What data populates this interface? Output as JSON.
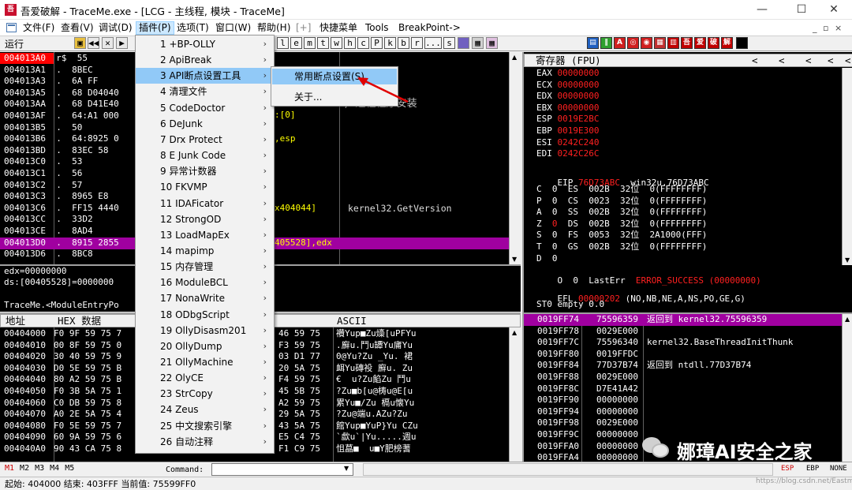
{
  "window": {
    "title": "吾爱破解 - TraceMe.exe - [LCG - 主线程, 模块 - TraceMe]",
    "logo_text": "吾",
    "minimize": "—",
    "maximize": "☐",
    "close": "✕",
    "mdi_controls": "_ ▫ ×"
  },
  "menubar": [
    {
      "label": "文件(F)"
    },
    {
      "label": "查看(V)"
    },
    {
      "label": "调试(D)"
    },
    {
      "label": "插件(P)"
    },
    {
      "label": "选项(T)"
    },
    {
      "label": "窗口(W)"
    },
    {
      "label": "帮助(H)"
    },
    {
      "label": "[+]"
    },
    {
      "label": "快捷菜单"
    },
    {
      "label": "Tools"
    },
    {
      "label": "BreakPoint->"
    }
  ],
  "toolbar": {
    "status": "运行",
    "letters": [
      "l",
      "e",
      "m",
      "t",
      "w",
      "h",
      "c",
      "P",
      "k",
      "b",
      "r",
      "...",
      "s"
    ],
    "colored": [
      "吾",
      "爱",
      "破",
      "解"
    ]
  },
  "plugins_menu": [
    {
      "label": "1 +BP-OLLY"
    },
    {
      "label": "2 ApiBreak"
    },
    {
      "label": "3 API断点设置工具"
    },
    {
      "label": "4 清理文件"
    },
    {
      "label": "5 CodeDoctor"
    },
    {
      "label": "6 DeJunk"
    },
    {
      "label": "7 Drx Protect"
    },
    {
      "label": "8 E Junk Code"
    },
    {
      "label": "9 异常计数器"
    },
    {
      "label": "10 FKVMP"
    },
    {
      "label": "11 IDAFicator"
    },
    {
      "label": "12 StrongOD"
    },
    {
      "label": "13 LoadMapEx"
    },
    {
      "label": "14 mapimp"
    },
    {
      "label": "15 内存管理"
    },
    {
      "label": "16 ModuleBCL"
    },
    {
      "label": "17 NonaWrite"
    },
    {
      "label": "18 ODbgScript"
    },
    {
      "label": "19 OllyDisasm201"
    },
    {
      "label": "20 OllyDump"
    },
    {
      "label": "21 OllyMachine"
    },
    {
      "label": "22 OlyCE"
    },
    {
      "label": "23 StrCopy"
    },
    {
      "label": "24 Zeus"
    },
    {
      "label": "25 中文搜索引擎"
    },
    {
      "label": "26 自动注释"
    }
  ],
  "sub_menu": [
    {
      "label": "常用断点设置(S)"
    },
    {
      "label": "关于..."
    }
  ],
  "disasm": {
    "rows": [
      {
        "addr": "004013A0",
        "mark": "r$",
        "bytes": "55"
      },
      {
        "addr": "004013A1",
        "mark": ".",
        "bytes": "8BEC"
      },
      {
        "addr": "004013A3",
        "mark": ".",
        "bytes": "6A FF"
      },
      {
        "addr": "004013A5",
        "mark": ".",
        "bytes": "68 D04040"
      },
      {
        "addr": "004013AA",
        "mark": ".",
        "bytes": "68 D41E40"
      },
      {
        "addr": "004013AF",
        "mark": ".",
        "bytes": "64:A1 000"
      },
      {
        "addr": "004013B5",
        "mark": ".",
        "bytes": "50"
      },
      {
        "addr": "004013B6",
        "mark": ".",
        "bytes": "64:8925 0"
      },
      {
        "addr": "004013BD",
        "mark": ".",
        "bytes": "83EC 58"
      },
      {
        "addr": "004013C0",
        "mark": ".",
        "bytes": "53"
      },
      {
        "addr": "004013C1",
        "mark": ".",
        "bytes": "56"
      },
      {
        "addr": "004013C2",
        "mark": ".",
        "bytes": "57"
      },
      {
        "addr": "004013C3",
        "mark": ".",
        "bytes": "8965 E8"
      },
      {
        "addr": "004013C6",
        "mark": ".",
        "bytes": "FF15 4440"
      },
      {
        "addr": "004013CC",
        "mark": ".",
        "bytes": "33D2"
      },
      {
        "addr": "004013CE",
        "mark": ".",
        "bytes": "8AD4"
      },
      {
        "addr": "004013D0",
        "mark": ".",
        "bytes": "8915 2855"
      },
      {
        "addr": "004013D6",
        "mark": ".",
        "bytes": "8BC8"
      }
    ],
    "asm_fragments": [
      {
        "text": ":[0]"
      },
      {
        "text": ",esp"
      },
      {
        "text": "x404044]"
      },
      {
        "text": "405528],edx"
      }
    ],
    "comments": [
      {
        "text": "; 进程程序安装"
      },
      {
        "text": "kernel32.GetVersion"
      }
    ]
  },
  "info_pane": {
    "line1": "edx=00000000",
    "line2": "ds:[00405528]=0000000",
    "line3": "TraceMe.<ModuleEntryPo"
  },
  "registers": {
    "header": "寄存器 (FPU)",
    "nav": [
      "<",
      "<",
      "<",
      "<",
      "<"
    ],
    "general": [
      {
        "name": "EAX",
        "value": "00000000"
      },
      {
        "name": "ECX",
        "value": "00000000"
      },
      {
        "name": "EDX",
        "value": "00000000"
      },
      {
        "name": "EBX",
        "value": "00000000"
      },
      {
        "name": "ESP",
        "value": "0019E2BC"
      },
      {
        "name": "EBP",
        "value": "0019E300"
      },
      {
        "name": "ESI",
        "value": "0242C240"
      },
      {
        "name": "EDI",
        "value": "0242C26C"
      }
    ],
    "eip": {
      "name": "EIP",
      "value": "76D73ABC",
      "comment": "win32u.76D73ABC"
    },
    "flags": [
      {
        "f": "C",
        "v": "0",
        "seg": "ES",
        "sel": "002B",
        "bits": "32位",
        "base": "0(FFFFFFFF)"
      },
      {
        "f": "P",
        "v": "0",
        "seg": "CS",
        "sel": "0023",
        "bits": "32位",
        "base": "0(FFFFFFFF)"
      },
      {
        "f": "A",
        "v": "0",
        "seg": "SS",
        "sel": "002B",
        "bits": "32位",
        "base": "0(FFFFFFFF)"
      },
      {
        "f": "Z",
        "v": "0",
        "seg": "DS",
        "sel": "002B",
        "bits": "32位",
        "base": "0(FFFFFFFF)"
      },
      {
        "f": "S",
        "v": "0",
        "seg": "FS",
        "sel": "0053",
        "bits": "32位",
        "base": "2A1000(FFF)"
      },
      {
        "f": "T",
        "v": "0",
        "seg": "GS",
        "sel": "002B",
        "bits": "32位",
        "base": "0(FFFFFFFF)"
      },
      {
        "f": "D",
        "v": "0",
        "seg": "",
        "sel": "",
        "bits": "",
        "base": ""
      }
    ],
    "lasterr_flag": "O  0",
    "lasterr_label": "LastErr",
    "lasterr_value": "ERROR_SUCCESS (00000000)",
    "efl_label": "EFL",
    "efl_value": "00000202",
    "efl_desc": "(NO,NB,NE,A,NS,PO,GE,G)",
    "st0": "ST0 empty 0.0"
  },
  "dump": {
    "col_addr": "地址",
    "col_hex": "HEX 数据",
    "col_ascii": "ASCII",
    "rows": [
      {
        "addr": "00404000",
        "hex": "F0 9F 59 75 7",
        "hex2": "46 59 75",
        "ascii": "禶Yup■Zu燺[uPFYu"
      },
      {
        "addr": "00404010",
        "hex": "00 8F 59 75 0",
        "hex2": "F3 59 75",
        "ascii": ".廯u.鬥u罈Yu庯Yu"
      },
      {
        "addr": "00404020",
        "hex": "30 40 59 75 9",
        "hex2": "D1 77",
        "ascii": "0@Yu?Zu _Yu. 裙"
      },
      {
        "addr": "00404030",
        "hex": "D0 5E 59 75 B",
        "hex2": "5A 75",
        "ascii": "衈Yu磚祋 廯u. Zu"
      },
      {
        "addr": "00404040",
        "hex": "80 A2 59 75 B",
        "hex2": "59 75",
        "ascii": "€  u?Zu餡Zu 鬥u"
      },
      {
        "addr": "00404050",
        "hex": "F0 3B 5A 75 1",
        "hex2": "5B 75",
        "ascii": "?Zu■b[u@梼u@E[u"
      },
      {
        "addr": "00404060",
        "hex": "C0 DB 59 75 8",
        "hex2": "59 75",
        "ascii": "累Yu■/Zu 槅u懐Yu"
      },
      {
        "addr": "00404070",
        "hex": "A0 2E 5A 75 4",
        "hex2": "5A 75",
        "ascii": "?Zu@端u.AZu?Zu"
      },
      {
        "addr": "00404080",
        "hex": "F0 5E 59 75 7",
        "hex2": "5A 75",
        "ascii": "館Yup■YuP}Yu CZu"
      },
      {
        "addr": "00404090",
        "hex": "60 9A 59 75 6",
        "hex2": "C4 75",
        "ascii": "`歔u`|Yu.....週u"
      },
      {
        "addr": "004040A0",
        "hex": "90 43 CA 75 8",
        "hex2": "C9 75",
        "ascii": "怚蕌■  u■Y肥榜蓍"
      }
    ],
    "hex_mid": "5A 75 0",
    "hex_mid_values": [
      "46 59 75",
      "F3 59 75",
      "03 D1 77",
      "20 5A 75",
      "F4 59 75",
      "45 5B 75",
      "A2 59 75",
      "29 5A 75",
      "43 5A 75",
      "E5 C4 75",
      "F1 C9 75"
    ]
  },
  "stack": {
    "rows": [
      {
        "addr": "0019FF74",
        "val": "75596359",
        "comment": "返回到 kernel32.75596359",
        "sel": true
      },
      {
        "addr": "0019FF78",
        "val": "0029E000",
        "comment": ""
      },
      {
        "addr": "0019FF7C",
        "val": "75596340",
        "comment": "kernel32.BaseThreadInitThunk"
      },
      {
        "addr": "0019FF80",
        "val": "0019FFDC",
        "comment": ""
      },
      {
        "addr": "0019FF84",
        "val": "77D37B74",
        "comment": "返回到 ntdll.77D37B74"
      },
      {
        "addr": "0019FF88",
        "val": "0029E000",
        "comment": ""
      },
      {
        "addr": "0019FF8C",
        "val": "D7E41A42",
        "comment": ""
      },
      {
        "addr": "0019FF90",
        "val": "00000000",
        "comment": ""
      },
      {
        "addr": "0019FF94",
        "val": "00000000",
        "comment": ""
      },
      {
        "addr": "0019FF98",
        "val": "0029E000",
        "comment": ""
      },
      {
        "addr": "0019FF9C",
        "val": "00000000",
        "comment": ""
      },
      {
        "addr": "0019FFA0",
        "val": "00000000",
        "comment": ""
      },
      {
        "addr": "0019FFA4",
        "val": "00000000",
        "comment": ""
      }
    ]
  },
  "cmdbar": {
    "marks": [
      "M1",
      "M2",
      "M3",
      "M4",
      "M5"
    ],
    "command_label": "Command:",
    "command_value": "",
    "right": [
      "ESP",
      "EBP",
      "NONE"
    ]
  },
  "statusbar": {
    "text": "起始: 404000 结束: 403FFF 当前值: 75599FF0",
    "url": "https://blog.csdn.net/Eastmount"
  },
  "watermark": {
    "text": "娜璋AI安全之家"
  },
  "colors": {
    "accent": "#cc0000",
    "selection_blue": "#91c9f7",
    "highlight_row": "#a000a0",
    "register_changed": "#ff0000"
  }
}
